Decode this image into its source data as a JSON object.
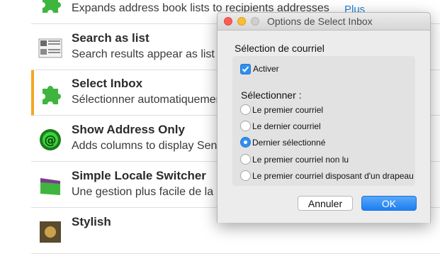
{
  "addons": [
    {
      "name": "",
      "description": "Expands address book lists to recipients addresses",
      "icon": "puzzle-icon",
      "more": "Plus"
    },
    {
      "name": "Search as list",
      "description": "Search results appear as list",
      "icon": "list-view-icon"
    },
    {
      "name": "Select Inbox",
      "description": "Sélectionner automatiquement",
      "icon": "puzzle-icon",
      "selected": true
    },
    {
      "name": "Show Address Only",
      "description": "Adds columns to display Sender",
      "icon": "green-globe-icon"
    },
    {
      "name": "Simple Locale Switcher",
      "description": "Une gestion plus facile de la l",
      "icon": "locale-flag-icon"
    },
    {
      "name": "Stylish",
      "description": "",
      "icon": "stylish-icon"
    }
  ],
  "dialog": {
    "title": "Options de Select Inbox",
    "group_label": "Sélection de courriel",
    "activate_label": "Activer",
    "activate_checked": true,
    "select_label": "Sélectionner :",
    "options": [
      {
        "label": "Le premier courriel",
        "checked": false
      },
      {
        "label": "Le dernier courriel",
        "checked": false
      },
      {
        "label": "Dernier sélectionné",
        "checked": true
      },
      {
        "label": "Le premier courriel non lu",
        "checked": false
      },
      {
        "label": "Le premier courriel disposant d'un drapeau",
        "checked": false
      }
    ],
    "cancel_label": "Annuler",
    "ok_label": "OK"
  },
  "colors": {
    "accent": "#2f8ff0",
    "selected_row_marker": "#f5a623",
    "link": "#2a82d9",
    "puzzle_green": "#3fb53f"
  }
}
